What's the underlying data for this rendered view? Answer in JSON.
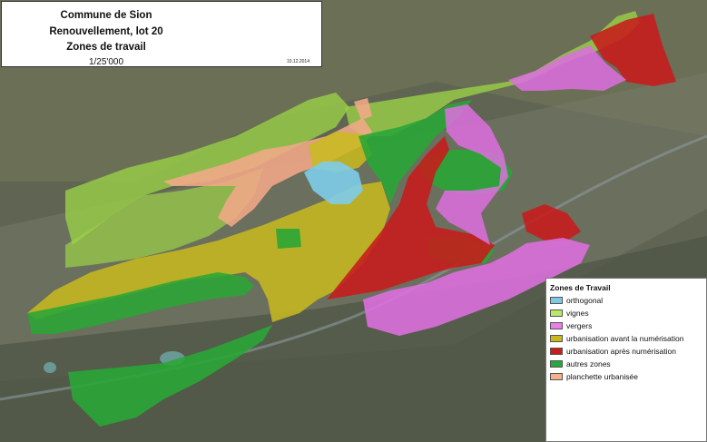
{
  "title": {
    "line1": "Commune de Sion",
    "line2": "Renouvellement, lot 20",
    "line3": "Zones de travail",
    "scale": "1/25'000",
    "date": "10.12.2014"
  },
  "legend": {
    "title": "Zones de Travail",
    "items": [
      {
        "label": "orthogonal",
        "color": "#7ec8e3"
      },
      {
        "label": "vignes",
        "color": "#b8e86c"
      },
      {
        "label": "vergers",
        "color": "#e87ee6"
      },
      {
        "label": "urbanisation avant la numérisation",
        "color": "#c7b81c"
      },
      {
        "label": "urbanisation après numérisation",
        "color": "#c91d1d"
      },
      {
        "label": "autres zones",
        "color": "#27a83a"
      },
      {
        "label": "planchette urbanisée",
        "color": "#f5b08c"
      }
    ]
  }
}
